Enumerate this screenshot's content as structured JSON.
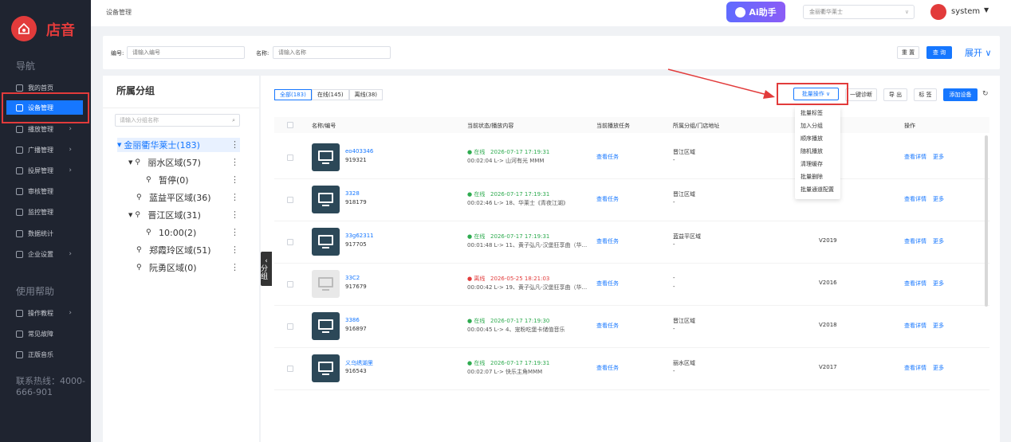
{
  "brand": {
    "name": "店音"
  },
  "sidebar": {
    "nav_title": "导航",
    "items": [
      {
        "label": "我的首页"
      },
      {
        "label": "设备管理"
      },
      {
        "label": "播放管理"
      },
      {
        "label": "广播管理"
      },
      {
        "label": "投屏管理"
      },
      {
        "label": "审核管理"
      },
      {
        "label": "监控管理"
      },
      {
        "label": "数据统计"
      },
      {
        "label": "企业设置"
      }
    ],
    "help_title": "使用帮助",
    "help_items": [
      {
        "label": "操作教程"
      },
      {
        "label": "常见故障"
      },
      {
        "label": "正版音乐"
      }
    ],
    "hotline": "联系热线：4000-666-901"
  },
  "topbar": {
    "breadcrumb": "设备管理",
    "ai_label": "Ai助手",
    "store": "金丽衢华莱士",
    "user": "system"
  },
  "filter": {
    "code_label": "编号:",
    "code_placeholder": "请输入编号",
    "name_label": "名称:",
    "name_placeholder": "请输入名称",
    "reset": "重 置",
    "query": "查 询",
    "expand": "展开 ∨"
  },
  "groups": {
    "title": "所属分组",
    "search_placeholder": "请输入分组名称",
    "tree": [
      {
        "label": "金丽衢华莱士(183)"
      },
      {
        "label": "丽水区域(57)"
      },
      {
        "label": "暂停(0)"
      },
      {
        "label": "蓝益平区域(36)"
      },
      {
        "label": "晋江区域(31)"
      },
      {
        "label": "10:00(2)"
      },
      {
        "label": "郑霞玲区域(51)"
      },
      {
        "label": "阮勇区域(0)"
      }
    ],
    "collapse": "分组"
  },
  "main": {
    "tabs": [
      {
        "label": "全部(183)"
      },
      {
        "label": "在线(145)"
      },
      {
        "label": "离线(38)"
      }
    ],
    "toolbar": {
      "batch": "批量操作",
      "diagnose": "一键诊断",
      "export": "导 出",
      "tag": "标 签",
      "add": "添加设备"
    },
    "batch_menu": [
      "批量标签",
      "加入分组",
      "顺序播放",
      "随机播放",
      "清理缓存",
      "批量删除",
      "批量通道配置"
    ],
    "columns": {
      "name": "名称/编号",
      "status": "当前状态/播放内容",
      "task": "当前播放任务",
      "group": "所属分组/门店地址",
      "ops": "操作"
    },
    "rows": [
      {
        "name": "eo403346",
        "code": "919321",
        "status": "在线",
        "time": "2026-07-17 17:19:31",
        "content": "00:02:04 L-> 山河有光 MMM",
        "task": "查看任务",
        "group": "晋江区域",
        "addr": "-",
        "version": "",
        "detail": "查看详情",
        "more": "更多"
      },
      {
        "name": "3328",
        "code": "918179",
        "status": "在线",
        "time": "2026-07-17 17:19:31",
        "content": "00:02:46 L-> 18、华莱士《青夜江湖》",
        "task": "查看任务",
        "group": "晋江区域",
        "addr": "-",
        "version": "",
        "detail": "查看详情",
        "more": "更多"
      },
      {
        "name": "33g62311",
        "code": "917705",
        "status": "在线",
        "time": "2026-07-17 17:19:31",
        "content": "00:01:48 L-> 11、黄子弘凡-汉堡狂享曲（华...",
        "task": "查看任务",
        "group": "蓝益平区域",
        "addr": "-",
        "version": "V2019",
        "detail": "查看详情",
        "more": "更多"
      },
      {
        "name": "33C2",
        "code": "917679",
        "status": "离线",
        "time": "2026-05-25 18:21:03",
        "content": "00:00:42 L-> 19、黄子弘凡-汉堡狂享曲（华...",
        "task": "查看任务",
        "group": "-",
        "addr": "-",
        "version": "V2016",
        "detail": "查看详情",
        "more": "更多"
      },
      {
        "name": "3386",
        "code": "916897",
        "status": "在线",
        "time": "2026-07-17 17:19:30",
        "content": "00:00:45 L-> 4、宠粉吃堡卡储值音乐",
        "task": "查看任务",
        "group": "晋江区域",
        "addr": "-",
        "version": "V2018",
        "detail": "查看详情",
        "more": "更多"
      },
      {
        "name": "义乌绣湖里",
        "code": "916543",
        "status": "在线",
        "time": "2026-07-17 17:19:31",
        "content": "00:02:07 L-> 快乐主角MMM",
        "task": "查看任务",
        "group": "丽水区域",
        "addr": "-",
        "version": "V2017",
        "detail": "查看详情",
        "more": "更多"
      }
    ]
  }
}
